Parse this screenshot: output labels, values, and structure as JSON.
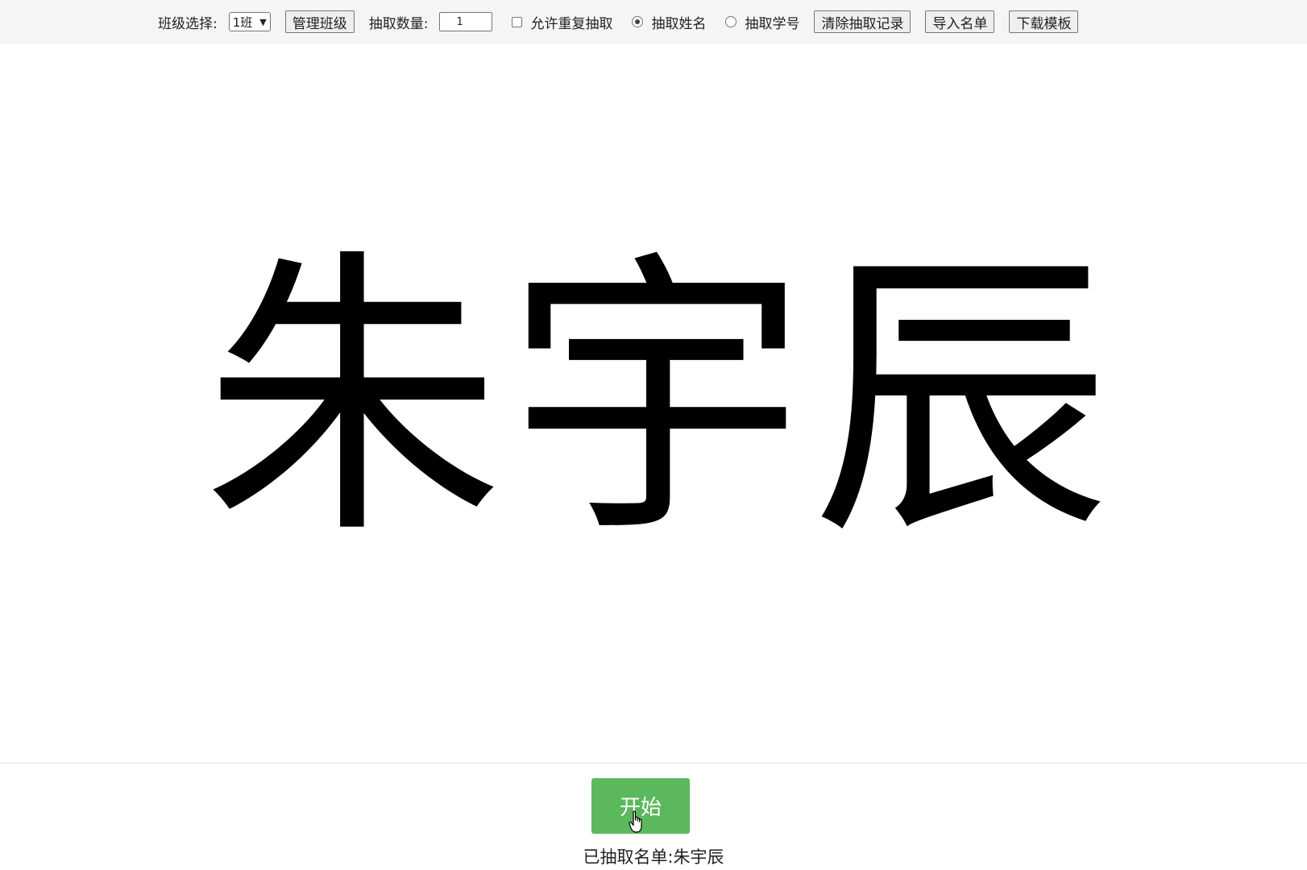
{
  "toolbar": {
    "class_label": "班级选择:",
    "class_selected": "1班",
    "manage_class_label": "管理班级",
    "count_label": "抽取数量:",
    "count_value": "1",
    "allow_repeat_label": "允许重复抽取",
    "mode_name_label": "抽取姓名",
    "mode_id_label": "抽取学号",
    "clear_records_label": "清除抽取记录",
    "import_list_label": "导入名单",
    "download_template_label": "下载模板"
  },
  "state": {
    "allow_repeat_checked": false,
    "mode_selected": "抽取姓名"
  },
  "display": {
    "current_name": "朱宇辰"
  },
  "controls": {
    "start_label": "开始"
  },
  "drawn": {
    "label": "已抽取名单:",
    "names": "朱宇辰"
  },
  "colors": {
    "start_button": "#5cb85c",
    "toolbar_bg": "#f5f5f5"
  },
  "icons": {
    "select_arrow": "chevron-down-icon",
    "cursor": "hand-pointer-icon"
  }
}
